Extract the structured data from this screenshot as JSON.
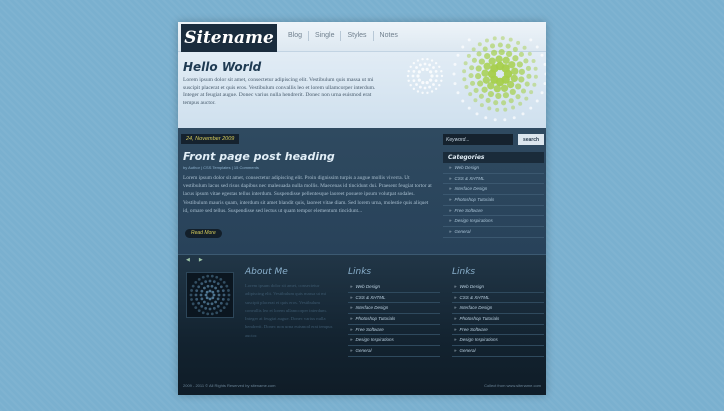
{
  "header": {
    "logo": "Sitename",
    "nav": [
      "Blog",
      "Single",
      "Styles",
      "Notes"
    ],
    "title": "Hello World",
    "text": "Lorem ipsum dolor sit amet, consectetur adipiscing elit. Vestibulum quis massa ut mi suscipit placerat et quis eros. Vestibulum convallis leo et lorem ullamcorper interdum. Integer at feugiat augue. Donec varius nulla hendrerit. Donec non urna euismod erat tempus auctor."
  },
  "post": {
    "date": "24, November 2009",
    "heading": "Front page post heading",
    "meta": "by Author | CSS Templates | 15 Comments",
    "body": "Lorem ipsum dolor sit amet, consectetur adipiscing elit. Proin dignissim turpis a augue mollis viverra. Ut vestibulum lacus sed risus dapibus nec malesuada nulla mollis. Maecenas id tincidunt dui. Praesent feugiat tortor at lacus ipsum vitae egestas tellus interdum. Suspendisse pellentesque laoreet posuere ipsum volutpat sodales. Vestibulum mauris quam, interdum sit amet blandit quis, laoreet vitae diam. Sed lorem urna, molestie quis aliquet id, ornare sed tellus. Suspendisse sed lectus ut quam tempor elementum tincidunt...",
    "read_more": "Read More"
  },
  "sidebar": {
    "search_placeholder": "Keyword...",
    "search_button": "search",
    "categories_title": "Categories",
    "categories": [
      "Web Design",
      "CSS & XHTML",
      "Interface Design",
      "Photoshop Tutorials",
      "Free Software",
      "Design Inspirations",
      "General"
    ]
  },
  "footer": {
    "about_title": "About Me",
    "about_text": "Lorem ipsum dolor sit amet, consectetur adipiscing elit. Vestibulum quis massa ut mi suscipit placerat et quis eros. Vestibulum convallis leo et lorem ullamcorper interdum. Integer at feugiat augue. Donec varius nulla hendrerit. Donec non urna euismod erat tempus auctor.",
    "links1_title": "Links",
    "links1": [
      "Web Design",
      "CSS & XHTML",
      "Interface Design",
      "Photoshop Tutorials",
      "Free Software",
      "Design Inspirations",
      "General"
    ],
    "links2_title": "Links",
    "links2": [
      "Web Design",
      "CSS & XHTML",
      "Interface Design",
      "Photoshop Tutorials",
      "Free Software",
      "Design Inspirations",
      "General"
    ],
    "copyright": "2009 - 2011 © All Rights Reserved by sitename.com",
    "credit": "Collect from www.sitename.com"
  },
  "colors": {
    "page_bg": "#7ab0cf",
    "accent_yellow": "#d6cc5a",
    "accent_green": "#a5cf4a"
  }
}
